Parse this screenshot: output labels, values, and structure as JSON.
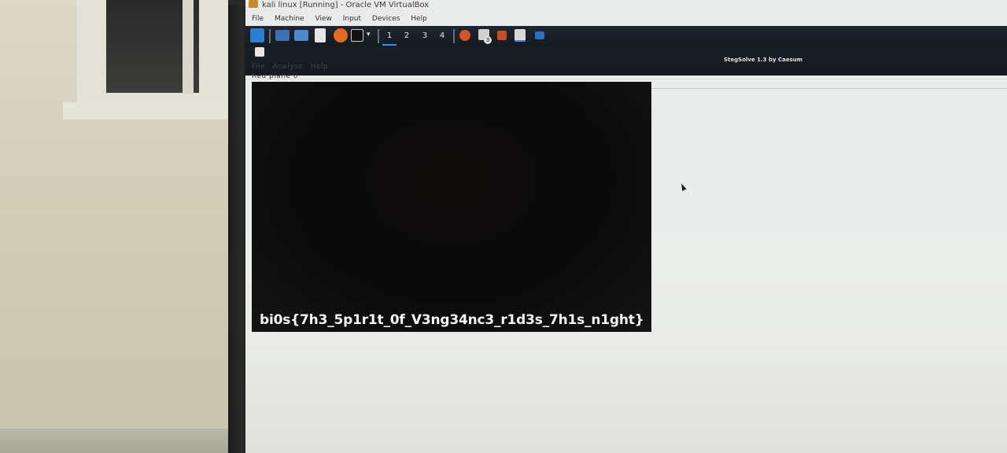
{
  "window": {
    "title": "kali linux [Running] - Oracle VM VirtualBox"
  },
  "vbox_menu": [
    "File",
    "Machine",
    "View",
    "Input",
    "Devices",
    "Help"
  ],
  "panel": {
    "workspaces": [
      "1",
      "2",
      "3",
      "4"
    ],
    "active_workspace": "1",
    "badge_count": "3"
  },
  "stegsolve": {
    "title": "StegSolve 1.3 by Caesum",
    "menu": [
      "File",
      "Analyse",
      "Help"
    ],
    "plane_label": "Red plane 0",
    "flag_text": "bi0s{7h3_5p1r1t_0f_V3ng34nc3_r1d3s_7h1s_n1ght}"
  },
  "colors": {
    "panel_bg": "#1a1f26",
    "accent": "#3a8ee6",
    "image_bg": "#0b0a0a"
  }
}
